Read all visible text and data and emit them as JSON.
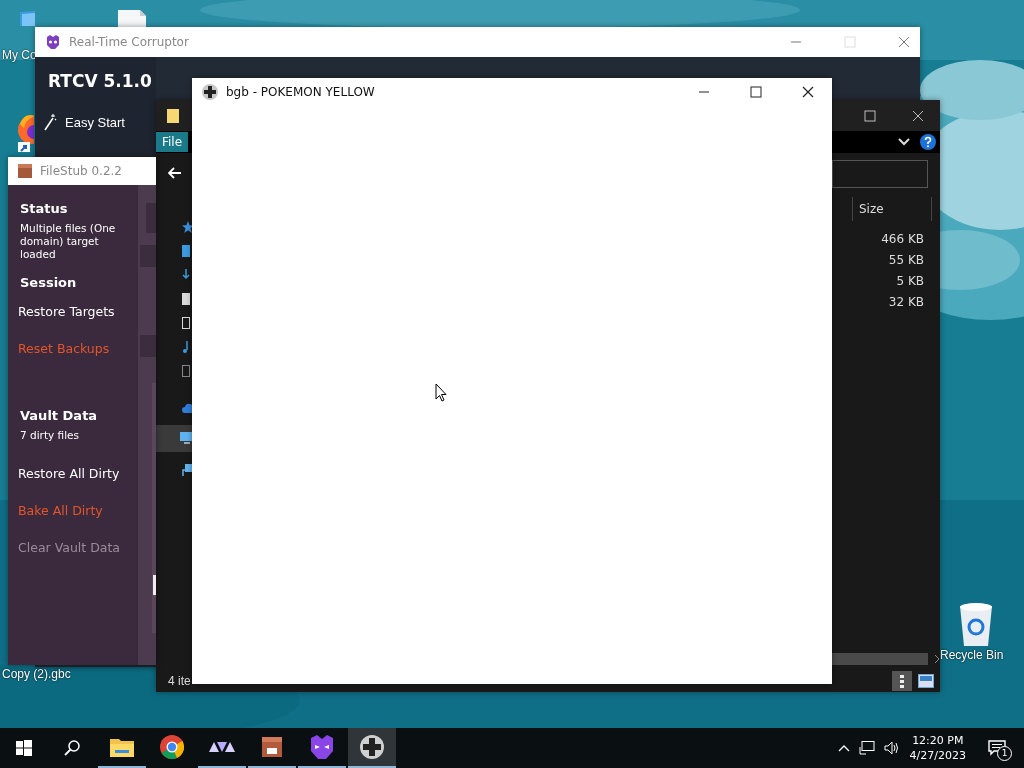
{
  "desktop": {
    "icons": [
      {
        "kind": "monitor",
        "label": "My Co"
      },
      {
        "kind": "document"
      },
      {
        "kind": "browser"
      },
      {
        "kind": "file",
        "label": "Copy (2).gbc"
      },
      {
        "kind": "recycle-bin",
        "label": "Recycle Bin"
      }
    ]
  },
  "rtcv": {
    "title": "Real-Time Corruptor",
    "heading": "RTCV 5.1.0",
    "menu": [
      {
        "label": "Easy Start"
      }
    ]
  },
  "explorer": {
    "ribbon_tab": "File",
    "columns": [
      "Size"
    ],
    "rows": [
      {
        "size": "466 KB"
      },
      {
        "size": "55 KB"
      },
      {
        "size": "5 KB"
      },
      {
        "size": "32 KB"
      }
    ],
    "status": "4 ite"
  },
  "filestub": {
    "title": "FileStub 0.2.2",
    "items": [
      {
        "kind": "heading",
        "text": "Status"
      },
      {
        "kind": "note",
        "text": "Multiple files (One domain) target loaded"
      },
      {
        "kind": "heading",
        "text": "Session"
      },
      {
        "kind": "action",
        "text": "Restore Targets"
      },
      {
        "kind": "danger",
        "text": "Reset Backups"
      },
      {
        "kind": "heading",
        "text": "Vault Data"
      },
      {
        "kind": "note",
        "text": "7 dirty files"
      },
      {
        "kind": "action",
        "text": "Restore All Dirty"
      },
      {
        "kind": "danger",
        "text": "Bake All Dirty"
      },
      {
        "kind": "disabled",
        "text": "Clear Vault Data"
      }
    ]
  },
  "bgb": {
    "title": "bgb - POKEMON YELLOW"
  },
  "taskbar": {
    "apps": [
      {
        "kind": "explorer",
        "running": true,
        "selected": false
      },
      {
        "kind": "chrome",
        "running": false,
        "selected": false
      },
      {
        "kind": "rtcv",
        "running": true,
        "selected": false
      },
      {
        "kind": "filestub",
        "running": true,
        "selected": false
      },
      {
        "kind": "corruptor",
        "running": true,
        "selected": false
      },
      {
        "kind": "bgb",
        "running": true,
        "selected": true
      }
    ],
    "tray": {
      "time": "12:20 PM",
      "date": "4/27/2023",
      "notifications": "1"
    }
  }
}
